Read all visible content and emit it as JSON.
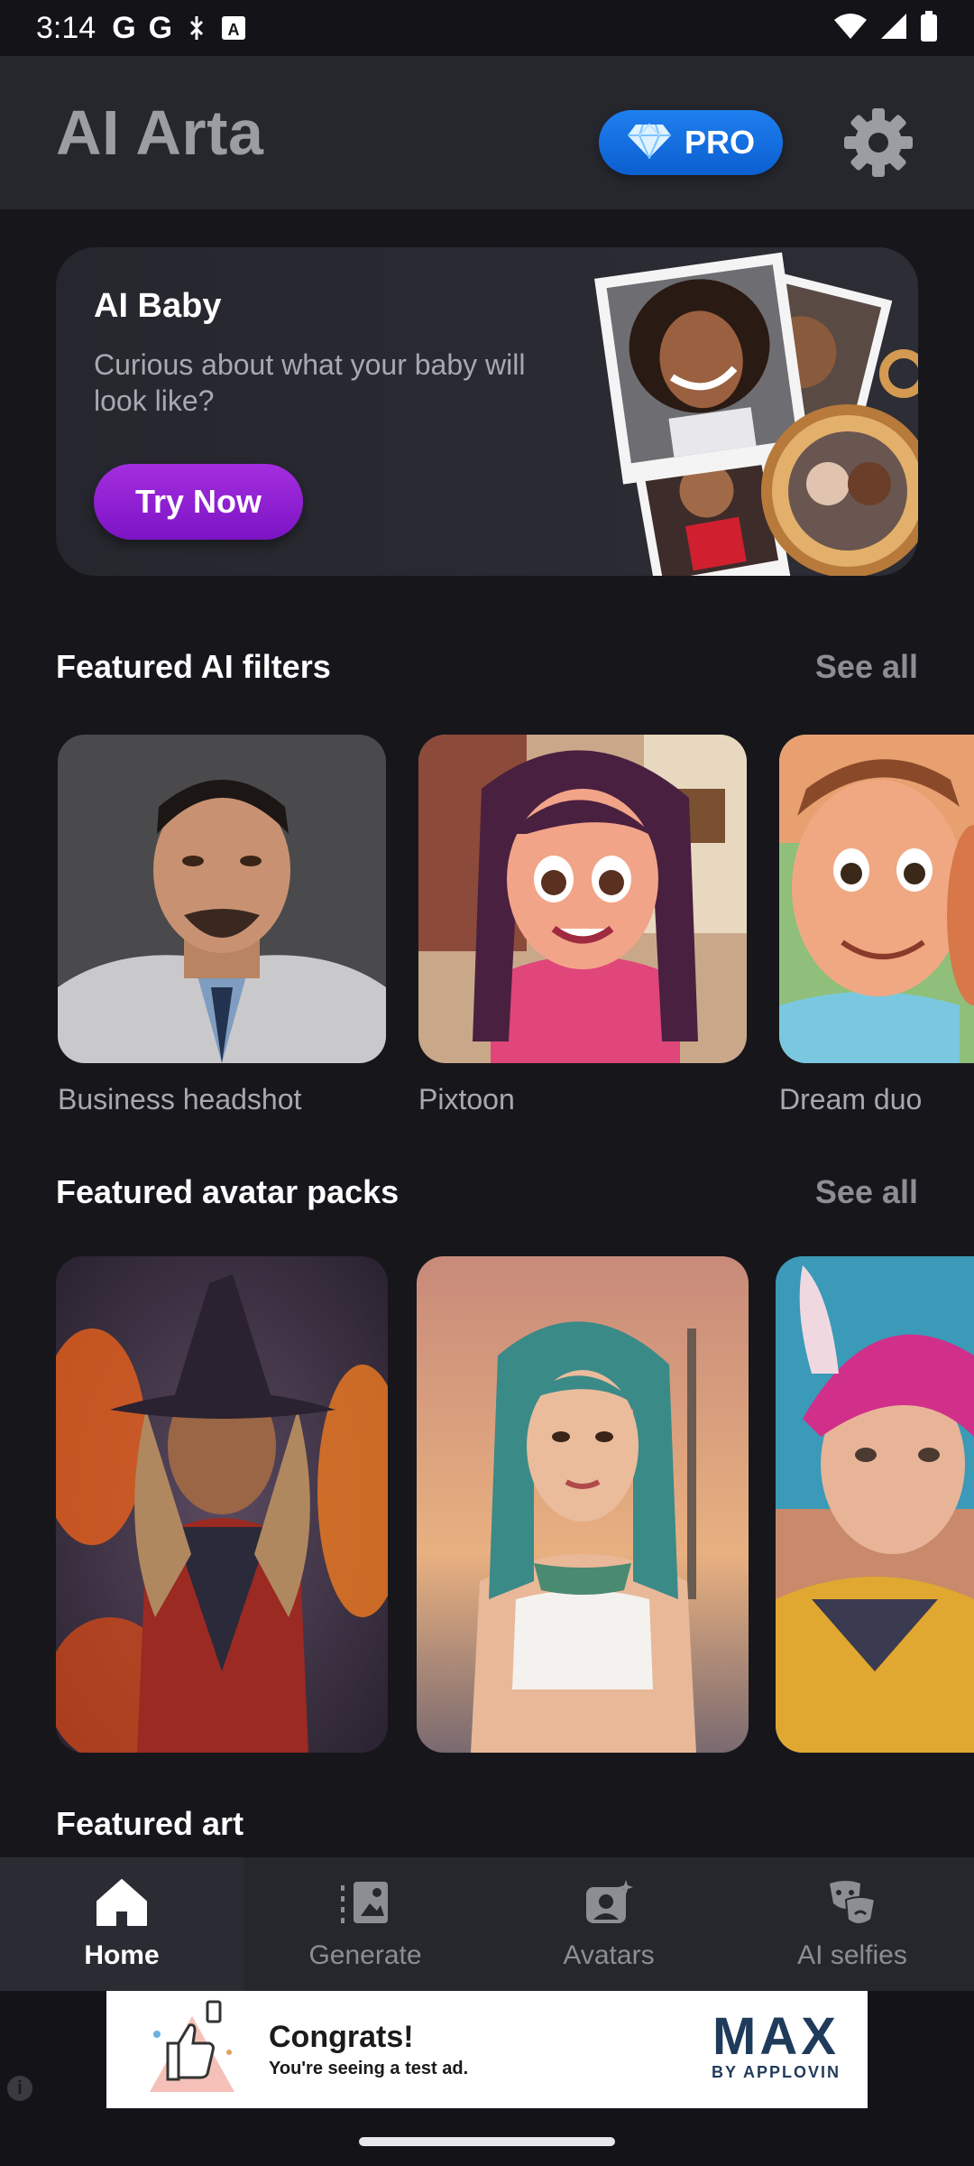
{
  "status_bar": {
    "time": "3:14",
    "icons": [
      "google-icon",
      "google-icon",
      "data-saver-icon",
      "a-icon",
      "wifi-icon",
      "signal-icon",
      "battery-icon"
    ]
  },
  "app_bar": {
    "title": "AI Arta",
    "pro_label": "PRO",
    "pro_color": "#1a73e8"
  },
  "promo": {
    "title": "AI Baby",
    "subtitle": "Curious about what your baby will look like?",
    "button_label": "Try Now",
    "button_color": "#9b27d8"
  },
  "filters": {
    "title": "Featured AI filters",
    "see_all": "See all",
    "items": [
      {
        "label": "Business headshot"
      },
      {
        "label": "Pixtoon"
      },
      {
        "label": "Dream duo"
      }
    ]
  },
  "avatars": {
    "title": "Featured avatar packs",
    "see_all": "See all"
  },
  "art": {
    "title": "Featured art"
  },
  "nav": {
    "items": [
      {
        "label": "Home",
        "icon": "home-icon",
        "active": true
      },
      {
        "label": "Generate",
        "icon": "generate-icon",
        "active": false
      },
      {
        "label": "Avatars",
        "icon": "avatars-icon",
        "active": false
      },
      {
        "label": "AI selfies",
        "icon": "masks-icon",
        "active": false
      }
    ]
  },
  "ad": {
    "title": "Congrats!",
    "subtitle": "You're seeing a test ad.",
    "brand": "MAX",
    "brand_sub": "BY APPLOVIN",
    "info": "i"
  }
}
